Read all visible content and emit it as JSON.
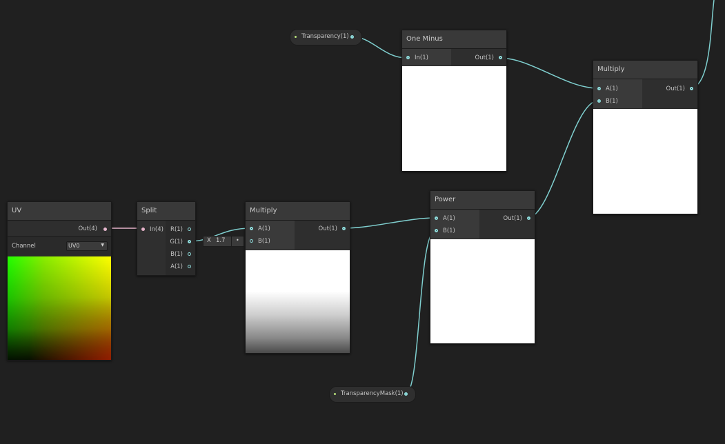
{
  "nodes": {
    "uv": {
      "title": "UV",
      "out_label": "Out(4)",
      "channel_label": "Channel",
      "channel_value": "UV0"
    },
    "split": {
      "title": "Split",
      "in_label": "In(4)",
      "outputs": [
        "R(1)",
        "G(1)",
        "B(1)",
        "A(1)"
      ]
    },
    "multiply1": {
      "title": "Multiply",
      "inputs": [
        "A(1)",
        "B(1)"
      ],
      "out_label": "Out(1)",
      "inline_axis": "X",
      "inline_value": "1.7"
    },
    "one_minus": {
      "title": "One Minus",
      "in_label": "In(1)",
      "out_label": "Out(1)"
    },
    "power": {
      "title": "Power",
      "inputs": [
        "A(1)",
        "B(1)"
      ],
      "out_label": "Out(1)"
    },
    "multiply2": {
      "title": "Multiply",
      "inputs": [
        "A(1)",
        "B(1)"
      ],
      "out_label": "Out(1)"
    }
  },
  "properties": {
    "transparency": "Transparency(1)",
    "transparency_mask": "TransparencyMask(1)"
  },
  "colors": {
    "wire": "#7fcfcf",
    "uv_wire": "#e6b3ca",
    "background": "#202020",
    "node_header": "#393939"
  }
}
